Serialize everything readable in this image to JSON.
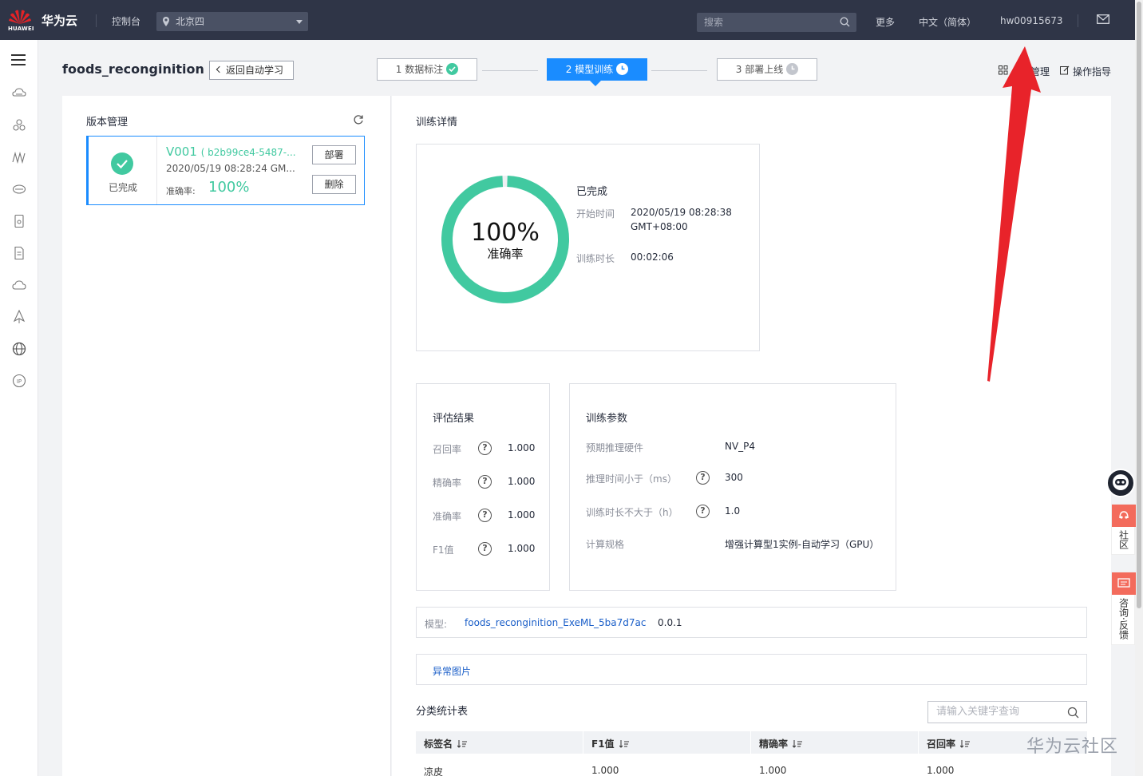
{
  "topbar": {
    "logo_text": "HUAWEI",
    "brand": "华为云",
    "console": "控制台",
    "region": "北京四",
    "search_placeholder": "搜索",
    "more": "更多",
    "language": "中文（简体）",
    "user": "hw00915673"
  },
  "header": {
    "project_title": "foods_reconginition",
    "back_button": "返回自动学习",
    "steps": [
      {
        "label": "1 数据标注",
        "state": "done"
      },
      {
        "label": "2 模型训练",
        "state": "active"
      },
      {
        "label": "3 部署上线",
        "state": "pending"
      }
    ],
    "manage_link": "管理",
    "guide_link": "操作指导"
  },
  "version_panel": {
    "title": "版本管理",
    "card": {
      "status": "已完成",
      "version": "V001",
      "version_id": "( b2b99ce4-5487-...",
      "date": "2020/05/19 08:28:24 GM...",
      "accuracy_label": "准确率:",
      "accuracy": "100%",
      "deploy_button": "部署",
      "delete_button": "删除"
    }
  },
  "training": {
    "title": "训练详情",
    "progress": 1.0,
    "donut_value": "100%",
    "donut_label": "准确率",
    "status": "已完成",
    "start_label": "开始时间",
    "start_value_1": "2020/05/19 08:28:38",
    "start_value_2": "GMT+08:00",
    "duration_label": "训练时长",
    "duration_value": "00:02:06"
  },
  "evaluation": {
    "title": "评估结果",
    "rows": [
      {
        "label": "召回率",
        "value": "1.000"
      },
      {
        "label": "精确率",
        "value": "1.000"
      },
      {
        "label": "准确率",
        "value": "1.000"
      },
      {
        "label": "F1值",
        "value": "1.000"
      }
    ]
  },
  "params": {
    "title": "训练参数",
    "rows": [
      {
        "label": "预期推理硬件",
        "value": "NV_P4",
        "help": false
      },
      {
        "label": "推理时间小于（ms）",
        "value": "300",
        "help": true
      },
      {
        "label": "训练时长不大于（h）",
        "value": "1.0",
        "help": true
      },
      {
        "label": "计算规格",
        "value": "增强计算型1实例-自动学习（GPU）",
        "help": false
      }
    ]
  },
  "model": {
    "label": "模型:",
    "name": "foods_reconginition_ExeML_5ba7d7ac",
    "version": "0.0.1"
  },
  "abnormal_images": "异常图片",
  "stats_table": {
    "title": "分类统计表",
    "search_placeholder": "请输入关键字查询",
    "columns": [
      "标签名",
      "F1值",
      "精确率",
      "召回率"
    ],
    "rows": [
      [
        "凉皮",
        "1.000",
        "1.000",
        "1.000"
      ]
    ]
  },
  "float_widget": {
    "community": "社区",
    "feedback": "咨询·反馈"
  },
  "watermark": "华为云社区",
  "colors": {
    "topbar": "#2f3547",
    "accent": "#1a8cff",
    "success": "#41c9a0",
    "annotation_arrow": "#e8232a"
  }
}
